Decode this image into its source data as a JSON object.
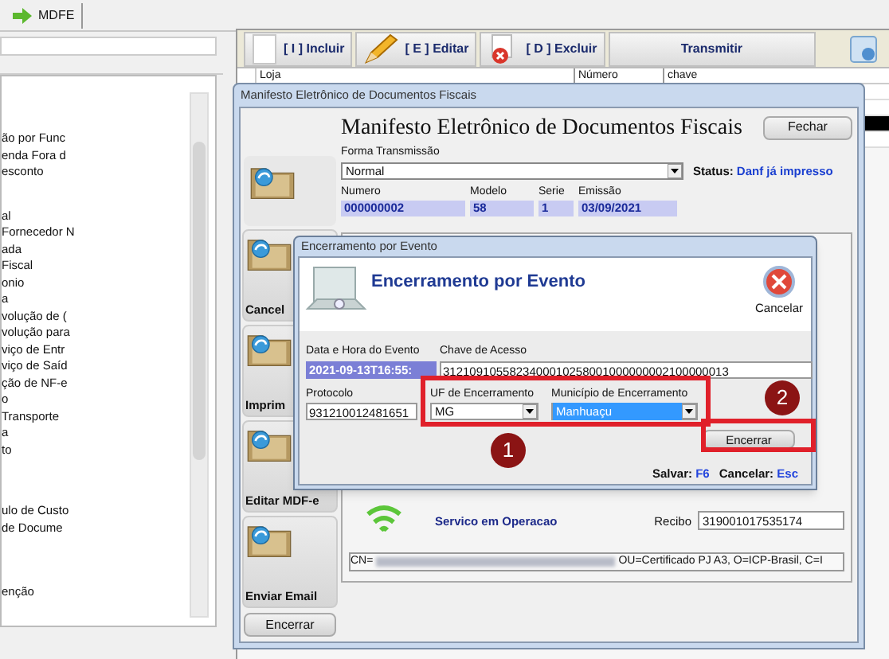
{
  "top_tab": {
    "label": "MDFE"
  },
  "tree": {
    "groups": [
      [
        "ão por Func",
        "enda Fora d",
        "esconto"
      ],
      [
        "al",
        "Fornecedor N",
        "ada",
        "Fiscal",
        "onio",
        "a",
        "volução de (",
        "volução para",
        "viço de Entr",
        "viço de Saíd",
        "ção de NF-e",
        "o",
        "Transporte",
        "a",
        "to"
      ],
      [
        "ulo de Custo",
        "de Docume"
      ],
      [
        "enção"
      ]
    ]
  },
  "toolbar": {
    "buttons": [
      {
        "kind": "new",
        "label": "[ I ] Incluir"
      },
      {
        "kind": "edit",
        "label": "[ E ] Editar"
      },
      {
        "kind": "delete",
        "label": "[ D ] Excluir"
      },
      {
        "kind": "send",
        "label": "Transmitir"
      }
    ]
  },
  "grid": {
    "columns": [
      "Loja",
      "Número",
      "chave"
    ],
    "rows": [
      {
        "selected": false
      },
      {
        "selected": false
      },
      {
        "selected": true
      },
      {
        "selected": false
      }
    ]
  },
  "mdfe_window": {
    "title": "Manifesto Eletrônico de Documentos Fiscais",
    "heading": "Manifesto Eletrônico de Documentos Fiscais",
    "close_button": "Fechar",
    "side_actions": [
      {
        "label": "Cancel"
      },
      {
        "label": "Imprim"
      },
      {
        "label": "Editar MDF-e"
      },
      {
        "label": "Enviar Email"
      }
    ],
    "end_button": "Encerrar",
    "forma_label": "Forma Transmissão",
    "forma_value": "Normal",
    "status_label": "Status:",
    "status_value": "Danf já impresso",
    "fields": [
      {
        "label": "Numero",
        "value": "000000002"
      },
      {
        "label": "Modelo",
        "value": "58"
      },
      {
        "label": "Serie",
        "value": "1"
      },
      {
        "label": "Emissão",
        "value": "03/09/2021"
      }
    ],
    "service_status": "Servico em Operacao",
    "recibo_label": "Recibo",
    "recibo_value": "319001017535174",
    "certificate_prefix": "CN=",
    "certificate_suffix": "OU=Certificado PJ A3, O=ICP-Brasil, C=I"
  },
  "dialog": {
    "title": "Encerramento por Evento",
    "heading": "Encerramento por Evento",
    "cancel_label": "Cancelar",
    "date_label": "Data e Hora do Evento",
    "date_value": "2021-09-13T16:55:",
    "chave_label": "Chave de Acesso",
    "chave_value": "3121091055823400010258001000000002100000013",
    "protocolo_label": "Protocolo",
    "protocolo_value": "931210012481651",
    "uf_label": "UF de Encerramento",
    "uf_value": "MG",
    "municipio_label": "Município de Encerramento",
    "municipio_value": "Manhuaçu",
    "confirm_button": "Encerrar",
    "save_label": "Salvar:",
    "save_key": "F6",
    "cancel_key_label": "Cancelar:",
    "cancel_key": "Esc"
  },
  "annotations": [
    {
      "label": "1"
    },
    {
      "label": "2"
    }
  ]
}
